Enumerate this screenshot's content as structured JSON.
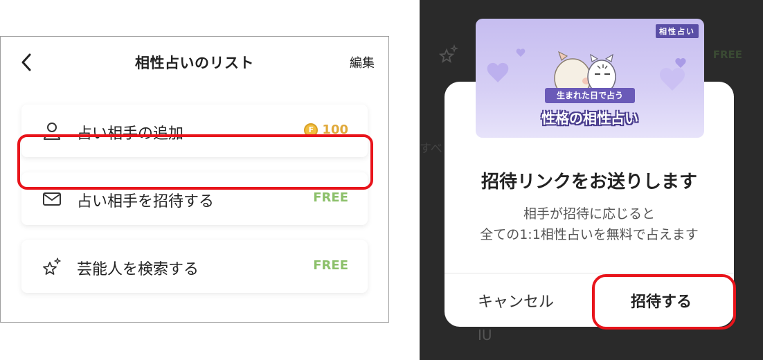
{
  "left": {
    "title": "相性占いのリスト",
    "edit_label": "編集",
    "items": [
      {
        "label": "占い相手の追加",
        "icon": "person-icon",
        "price": "100",
        "coin_letter": "F"
      },
      {
        "label": "占い相手を招待する",
        "icon": "envelope-icon",
        "price": "FREE"
      },
      {
        "label": "芸能人を検索する",
        "icon": "sparkle-star-icon",
        "price": "FREE"
      }
    ]
  },
  "background": {
    "free": "FREE",
    "partial_text": "すべ",
    "name": "IU"
  },
  "banner": {
    "tag": "相性占い",
    "ribbon": "生まれた日で占う",
    "title": "性格の相性占い"
  },
  "dialog": {
    "title": "招待リンクをお送りします",
    "message_line1": "相手が招待に応じると",
    "message_line2": "全ての1:1相性占いを無料で占えます",
    "cancel_label": "キャンセル",
    "invite_label": "招待する"
  },
  "colors": {
    "free_green": "#8cc06a",
    "coin_gold": "#e0a93a",
    "highlight_red": "#e8141b",
    "banner_purple": "#5a4ea6"
  }
}
